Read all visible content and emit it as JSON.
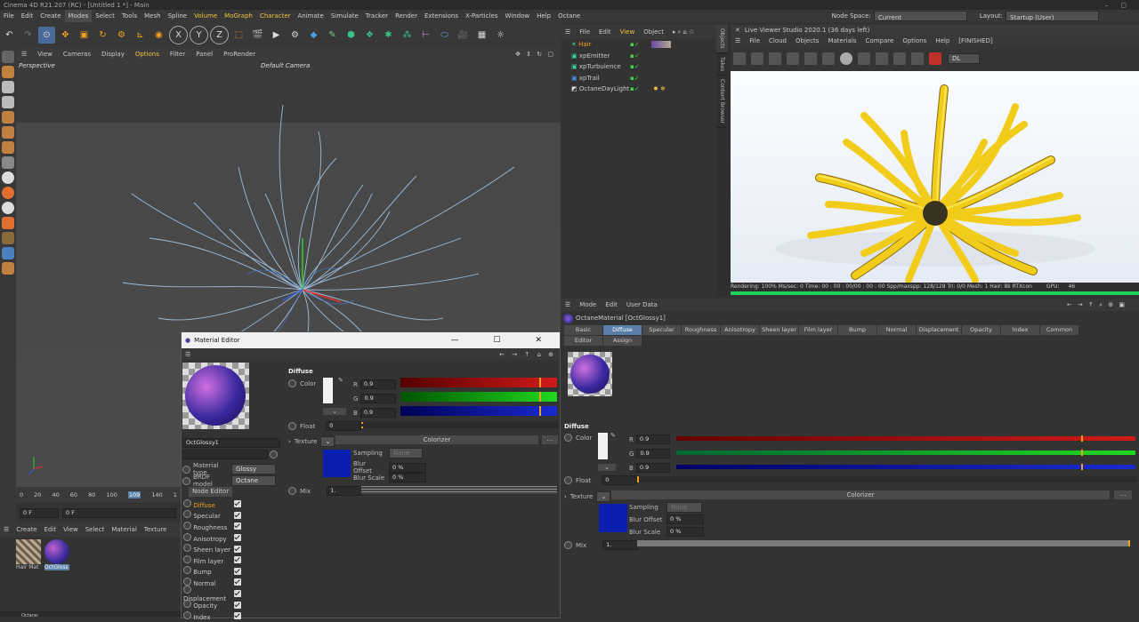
{
  "window": {
    "title": "Cinema 4D R21.207 (RC) - [Untitled 1 *] - Main"
  },
  "menu": {
    "items": [
      "File",
      "Edit",
      "Create",
      "Modes",
      "Select",
      "Tools",
      "Mesh",
      "Spline",
      "Volume",
      "MoGraph",
      "Character",
      "Animate",
      "Simulate",
      "Tracker",
      "Render",
      "Extensions",
      "X-Particles",
      "Window",
      "Help",
      "Octane"
    ],
    "active": "Modes",
    "node_space_label": "Node Space:",
    "node_space_value": "Current (Standard/Physical)",
    "layout_label": "Layout:",
    "layout_value": "Startup (User)"
  },
  "viewport": {
    "menu": [
      "View",
      "Cameras",
      "Display",
      "Options",
      "Filter",
      "Panel",
      "ProRender"
    ],
    "name": "Perspective",
    "camera": "Default Camera"
  },
  "timeline": {
    "ticks": [
      "0",
      "20",
      "40",
      "60",
      "80",
      "100",
      "109",
      "140",
      "1"
    ],
    "frame_start": "0 F",
    "frame_current": "0 F"
  },
  "material_manager": {
    "menu": [
      "Create",
      "Edit",
      "View",
      "Select",
      "Material",
      "Texture"
    ],
    "materials": [
      "Hair Mat",
      "OctGloss"
    ]
  },
  "status_bar": {
    "text": "Octane:"
  },
  "objects": {
    "menu": [
      "File",
      "Edit",
      "View",
      "Object"
    ],
    "items": [
      {
        "name": "Hair",
        "color": "#f0a020"
      },
      {
        "name": "xpEmitter",
        "color": "#d8d8d8"
      },
      {
        "name": "xpTurbulence",
        "color": "#d8d8d8"
      },
      {
        "name": "xpTrail",
        "color": "#d8d8d8"
      },
      {
        "name": "OctaneDayLight",
        "color": "#d8d8d8"
      }
    ],
    "side_tabs": [
      "Objects",
      "Takes",
      "Content Browser"
    ]
  },
  "live_viewer": {
    "title": "Live Viewer Studio 2020.1 (36 days left)",
    "menu": [
      "File",
      "Cloud",
      "Objects",
      "Materials",
      "Compare",
      "Options",
      "Help",
      "[FINISHED]"
    ],
    "mode": "DL",
    "status": "Rendering: 100%  Ms/sec: 0   Time: 00 : 00 : 00/00 : 00 : 00  Spp/maxspp: 128/128   Tri: 0/0   Mesh: 1  Hair: 8k  RTXcon",
    "gpu_label": "GPU:",
    "gpu_value": "46",
    "progress": 1.0
  },
  "attributes": {
    "menu": [
      "Mode",
      "Edit",
      "User Data"
    ],
    "title": "OctaneMaterial [OctGlossy1]",
    "tabs_row1": [
      "Basic",
      "Diffuse",
      "Specular",
      "Roughness",
      "Anisotropy",
      "Sheen layer",
      "Film layer",
      "Bump",
      "Normal",
      "Displacement",
      "Opacity",
      "Index",
      "Common"
    ],
    "tabs_row2": [
      "Editor",
      "Assign"
    ],
    "active_tab": "Diffuse",
    "section": "Diffuse",
    "color_label": "Color",
    "r": "0.9",
    "g": "0.9",
    "b": "0.9",
    "float_label": "Float",
    "float_value": "0",
    "texture_label": "Texture",
    "texture_name": "Colorizer",
    "sampling_label": "Sampling",
    "sampling_value": "None",
    "blur_offset_label": "Blur Offset",
    "blur_offset_value": "0 %",
    "blur_scale_label": "Blur Scale",
    "blur_scale_value": "0 %",
    "mix_label": "Mix",
    "mix_value": "1."
  },
  "material_editor": {
    "title": "Material Editor",
    "material_name": "OctGlossy1",
    "material_type_label": "Material type",
    "material_type_value": "Glossy",
    "brdf_label": "BRDF model",
    "brdf_value": "Octane",
    "node_editor_label": "Node Editor",
    "channels": [
      "Diffuse",
      "Specular",
      "Roughness",
      "Anisotropy",
      "Sheen layer",
      "Film layer",
      "Bump",
      "Normal",
      "Displacement",
      "Opacity",
      "Index"
    ],
    "active_channel": "Diffuse",
    "section": "Diffuse",
    "color_label": "Color",
    "r": "0.9",
    "g": "0.9",
    "b": "0.9",
    "float_label": "Float",
    "float_value": "0",
    "texture_label": "Texture",
    "texture_name": "Colorizer",
    "sampling_label": "Sampling",
    "sampling_value": "None",
    "blur_offset_label": "Blur Offset",
    "blur_offset_value": "0 %",
    "blur_scale_label": "Blur Scale",
    "blur_scale_value": "0 %",
    "mix_label": "Mix",
    "mix_value": "1."
  },
  "colors": {
    "accent": "#5a7fa8",
    "active_text": "#f0a020",
    "slider_red": "#d11a1a",
    "slider_green": "#1fb81f",
    "slider_blue": "#1a2ad1",
    "texture_swatch": "#0a1fb0"
  }
}
